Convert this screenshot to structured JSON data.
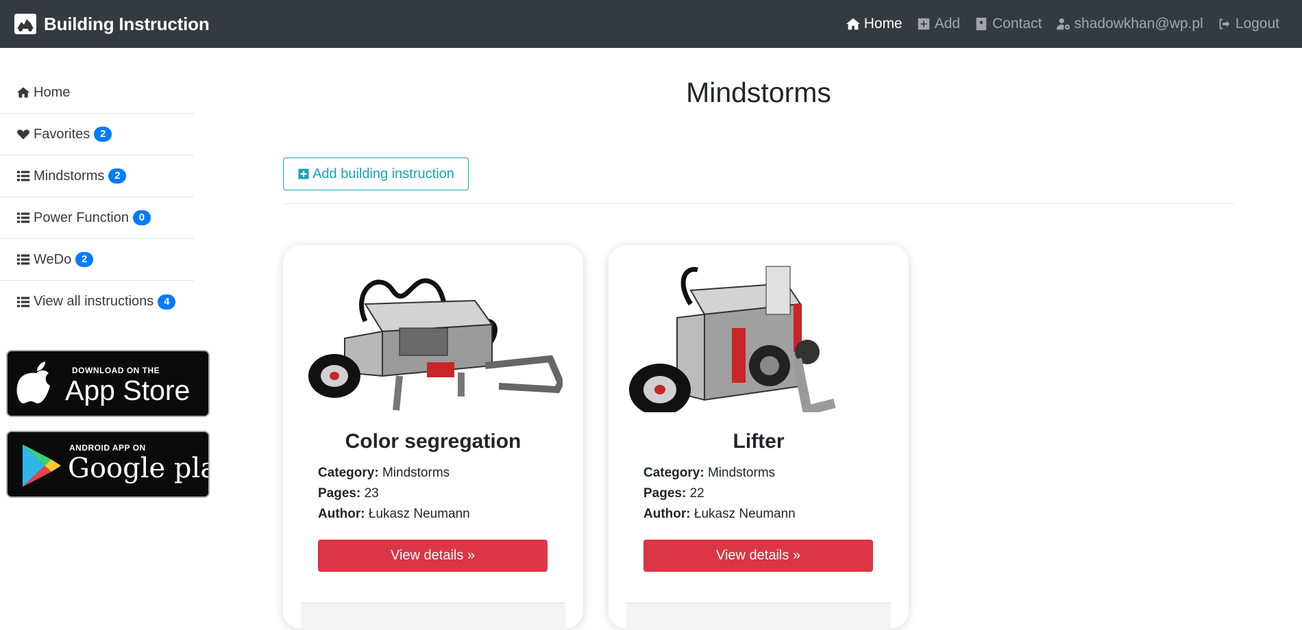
{
  "navbar": {
    "brand": "Building Instruction",
    "links": [
      {
        "label": "Home",
        "icon": "home-icon",
        "active": true
      },
      {
        "label": "Add",
        "icon": "plus-square-icon"
      },
      {
        "label": "Contact",
        "icon": "address-book-icon"
      },
      {
        "label": "shadowkhan@wp.pl",
        "icon": "user-cog-icon"
      },
      {
        "label": "Logout",
        "icon": "sign-out-icon"
      }
    ]
  },
  "sidebar": {
    "items": [
      {
        "label": "Home",
        "icon": "home-icon"
      },
      {
        "label": "Favorites",
        "icon": "heart-icon",
        "badge": "2"
      },
      {
        "label": "Mindstorms",
        "icon": "list-icon",
        "badge": "2"
      },
      {
        "label": "Power Function",
        "icon": "list-icon",
        "badge": "0"
      },
      {
        "label": "WeDo",
        "icon": "list-icon",
        "badge": "2"
      },
      {
        "label": "View all instructions",
        "icon": "list-icon",
        "badge": "4"
      }
    ],
    "app_store": {
      "small": "DOWNLOAD ON THE",
      "big": "App Store"
    },
    "google_play": {
      "small": "ANDROID APP ON",
      "big": "Google play"
    }
  },
  "main": {
    "title": "Mindstorms",
    "add_button": "Add building instruction",
    "labels": {
      "category": "Category:",
      "pages": "Pages:",
      "author": "Author:"
    },
    "cards": [
      {
        "title": "Color segregation",
        "category": "Mindstorms",
        "pages": "23",
        "author": "Łukasz Neumann",
        "button": "View details »"
      },
      {
        "title": "Lifter",
        "category": "Mindstorms",
        "pages": "22",
        "author": "Łukasz Neumann",
        "button": "View details »"
      }
    ]
  },
  "colors": {
    "navbar": "#343a40",
    "badge": "#007bff",
    "outline_button": "#17a2b8",
    "danger_button": "#dc3545"
  }
}
